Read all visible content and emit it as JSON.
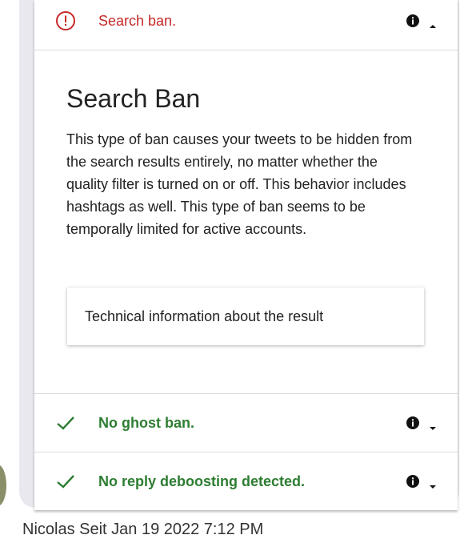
{
  "checks": [
    {
      "label": "Search ban.",
      "status": "failed",
      "info_icon": "info-icon",
      "caret": "caret-up-icon"
    },
    {
      "label": "No ghost ban.",
      "status": "passed",
      "info_icon": "info-icon",
      "caret": "caret-down-icon"
    },
    {
      "label": "No reply deboosting detected.",
      "status": "passed",
      "info_icon": "info-icon",
      "caret": "caret-down-icon"
    }
  ],
  "detail": {
    "title": "Search Ban",
    "text": "This type of ban causes your tweets to be hidden from the search results entirely, no matter whether the quality filter is turned on or off. This behavior includes hashtags as well. This type of ban seems to be temporally limited for active accounts.",
    "technical_button": "Technical information about the result"
  },
  "footer": {
    "text": "Nicolas Seit   Jan 19 2022 7:12 PM"
  },
  "colors": {
    "fail": "#c62828",
    "pass": "#2e7d32"
  }
}
